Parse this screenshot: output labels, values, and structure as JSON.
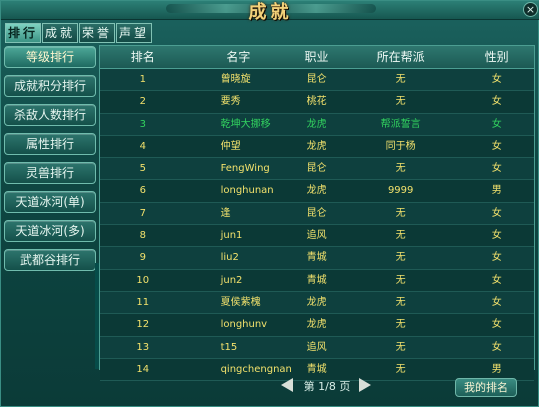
{
  "window": {
    "title": "成就"
  },
  "tabs": [
    {
      "label": "排行"
    },
    {
      "label": "成就"
    },
    {
      "label": "荣誉"
    },
    {
      "label": "声望"
    }
  ],
  "sidebar": {
    "items": [
      {
        "label": "等级排行"
      },
      {
        "label": "成就积分排行"
      },
      {
        "label": "杀敌人数排行"
      },
      {
        "label": "属性排行"
      },
      {
        "label": "灵兽排行"
      },
      {
        "label": "天道冰河(单)"
      },
      {
        "label": "天道冰河(多)"
      },
      {
        "label": "武都谷排行"
      }
    ]
  },
  "table": {
    "headers": [
      "排名",
      "名字",
      "职业",
      "所在帮派",
      "性别"
    ],
    "rows": [
      {
        "rank": "1",
        "name": "曾晓旋",
        "job": "昆仑",
        "guild": "无",
        "gender": "女"
      },
      {
        "rank": "2",
        "name": "要秀",
        "job": "桃花",
        "guild": "无",
        "gender": "女"
      },
      {
        "rank": "3",
        "name": "乾坤大挪移",
        "job": "龙虎",
        "guild": "帮派誓言",
        "gender": "女"
      },
      {
        "rank": "4",
        "name": "仲望",
        "job": "龙虎",
        "guild": "同于杨",
        "gender": "女"
      },
      {
        "rank": "5",
        "name": "FengWing",
        "job": "昆仑",
        "guild": "无",
        "gender": "女"
      },
      {
        "rank": "6",
        "name": "longhunan",
        "job": "龙虎",
        "guild": "9999",
        "gender": "男"
      },
      {
        "rank": "7",
        "name": "逢",
        "job": "昆仑",
        "guild": "无",
        "gender": "女"
      },
      {
        "rank": "8",
        "name": "jun1",
        "job": "追风",
        "guild": "无",
        "gender": "女"
      },
      {
        "rank": "9",
        "name": "liu2",
        "job": "青城",
        "guild": "无",
        "gender": "女"
      },
      {
        "rank": "10",
        "name": "jun2",
        "job": "青城",
        "guild": "无",
        "gender": "女"
      },
      {
        "rank": "11",
        "name": "夏侯紫槐",
        "job": "龙虎",
        "guild": "无",
        "gender": "女"
      },
      {
        "rank": "12",
        "name": "longhunv",
        "job": "龙虎",
        "guild": "无",
        "gender": "女"
      },
      {
        "rank": "13",
        "name": "t15",
        "job": "追风",
        "guild": "无",
        "gender": "女"
      },
      {
        "rank": "14",
        "name": "qingchengnan",
        "job": "青城",
        "guild": "无",
        "gender": "男"
      }
    ]
  },
  "pager": {
    "text": "第 1/8 页"
  },
  "buttons": {
    "my_rank": "我的排名"
  },
  "icons": {
    "close": "close-icon",
    "previous": "left-arrow-icon",
    "next": "right-arrow-icon"
  },
  "colors": {
    "highlight_row_text": "#32d25f",
    "normal_row_text": "#f2e16c"
  }
}
